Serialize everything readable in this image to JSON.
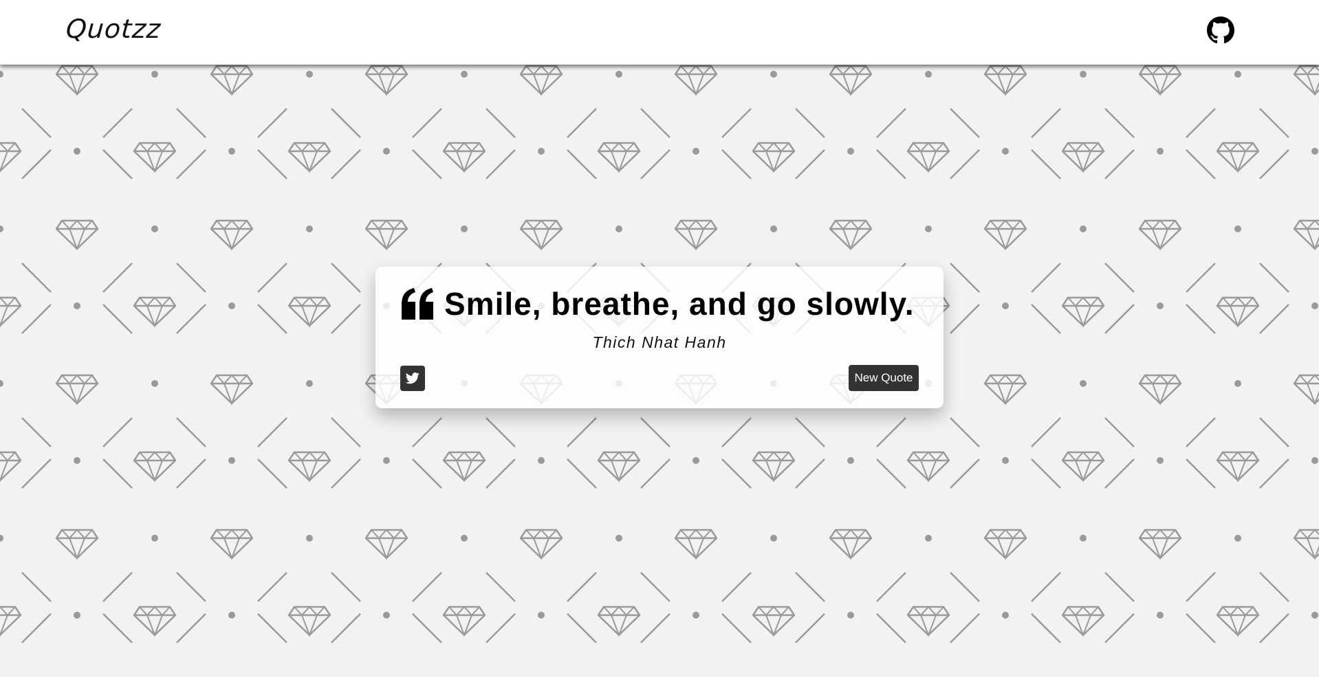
{
  "navbar": {
    "brand": "Quotzz",
    "github_icon": "github-icon"
  },
  "quote": {
    "icon": "quote-left-icon",
    "text": "Smile, breathe, and go slowly.",
    "author": "Thich Nhat Hanh"
  },
  "actions": {
    "tweet_icon": "twitter-icon",
    "new_quote_label": "New Quote"
  },
  "colors": {
    "background": "#f2f2f2",
    "pattern": "#9a9a9a",
    "button": "#333333",
    "navbar": "#ffffff"
  }
}
